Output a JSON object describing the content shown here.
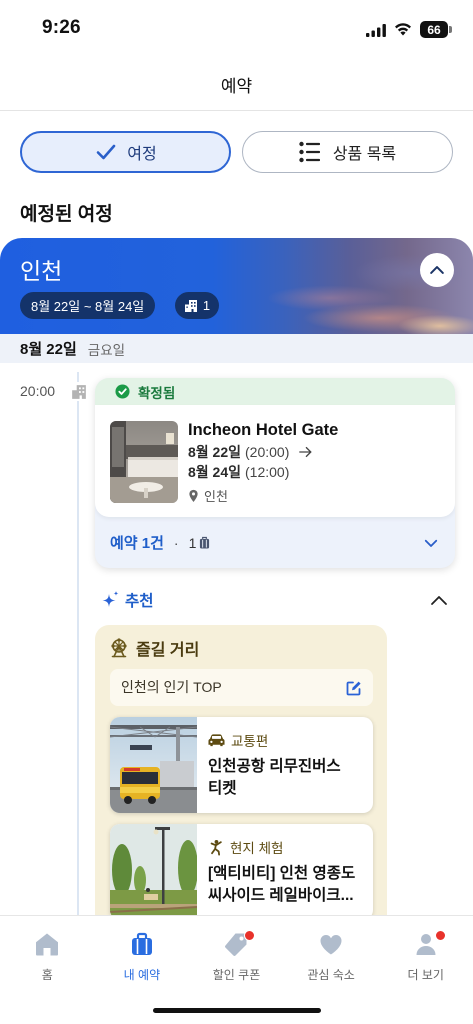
{
  "status_bar": {
    "time": "9:26",
    "battery": "66"
  },
  "header": {
    "title": "예약"
  },
  "segmented": {
    "trips": {
      "label": "여정",
      "selected": true,
      "icon": "check-icon"
    },
    "products": {
      "label": "상품 목록",
      "selected": false,
      "icon": "list-icon"
    }
  },
  "section_title": "예정된 여정",
  "trip": {
    "city": "인천",
    "date_range": "8월 22일 ~ 8월 24일",
    "property_count": "1",
    "date_header": {
      "date": "8월 22일",
      "weekday": "금요일"
    },
    "timeline_time": "20:00",
    "booking": {
      "status": "확정됨",
      "hotel_name": "Incheon Hotel Gate",
      "checkin_date": "8월 22일",
      "checkin_time": "(20:00)",
      "checkout_date": "8월 24일",
      "checkout_time": "(12:00)",
      "location": "인천",
      "summary_label": "예약 1건",
      "separator": "·",
      "item_count": "1"
    }
  },
  "recommendations": {
    "title": "추천",
    "category_title": "즐길 거리",
    "top_label": "인천의 인기 TOP",
    "items": [
      {
        "category": "교통편",
        "icon": "car-icon",
        "title": "인천공항 리무진버스 티켓"
      },
      {
        "category": "현지 체험",
        "icon": "activity-icon",
        "title": "[액티비티] 인천 영종도 씨사이드 레일바이크..."
      }
    ]
  },
  "tab_bar": {
    "tabs": [
      {
        "label": "홈",
        "icon": "home-icon",
        "active": false,
        "badge": false
      },
      {
        "label": "내 예약",
        "icon": "suitcase-icon",
        "active": true,
        "badge": false
      },
      {
        "label": "할인 쿠폰",
        "icon": "coupon-icon",
        "active": false,
        "badge": true
      },
      {
        "label": "관심 숙소",
        "icon": "heart-icon",
        "active": false,
        "badge": false
      },
      {
        "label": "더 보기",
        "icon": "person-icon",
        "active": false,
        "badge": true
      }
    ]
  },
  "colors": {
    "accent": "#2a62d6",
    "navy-chip": "#14336a",
    "confirmed-green": "#1b9a47",
    "beige-card": "#f6f0da",
    "active-tab": "#2a6de0",
    "inactive-tab-icon": "#b0bccc",
    "badge-red": "#e8322b"
  }
}
